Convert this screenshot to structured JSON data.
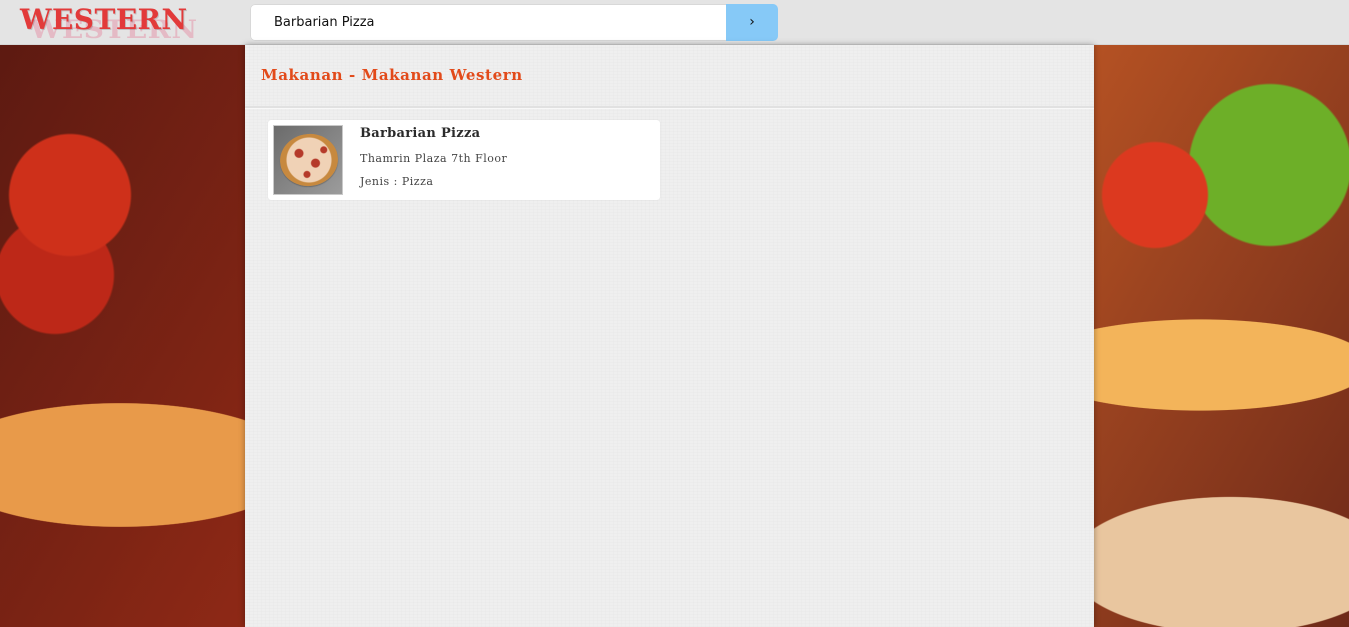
{
  "header": {
    "logo_text": "WESTERN",
    "search": {
      "value": "Barbarian Pizza",
      "placeholder": "",
      "button_label": "›"
    }
  },
  "panel": {
    "title": "Makanan - Makanan Western",
    "results": [
      {
        "name": "Barbarian Pizza",
        "address": "Thamrin Plaza 7th Floor",
        "type_line": "Jenis : Pizza",
        "thumb_alt": "Barbarian Pizza"
      }
    ]
  },
  "colors": {
    "topbar_bg": "#e4e4e4",
    "logo_red": "#e23a3a",
    "search_button_blue": "#86c9f7",
    "title_orange": "#e24a1a",
    "panel_bg": "#efefef"
  }
}
